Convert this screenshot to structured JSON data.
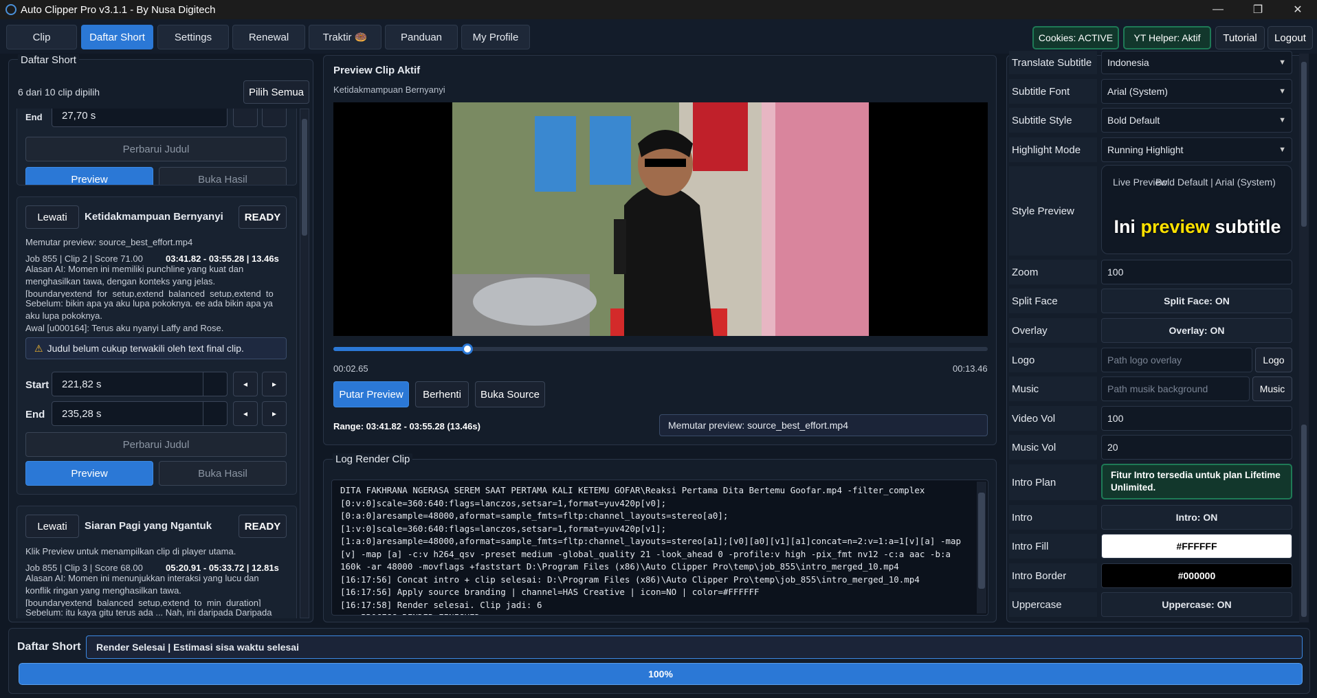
{
  "window": {
    "title": "Auto Clipper Pro v3.1.1 - By Nusa Digitech",
    "min": "—",
    "max": "❐",
    "close": "✕"
  },
  "nav": {
    "tabs": [
      "Clip",
      "Daftar Short",
      "Settings",
      "Renewal",
      "Traktir 🍩",
      "Panduan",
      "My Profile"
    ],
    "cookies": "Cookies: ACTIVE",
    "yt_helper": "YT Helper: Aktif",
    "tutorial": "Tutorial",
    "logout": "Logout"
  },
  "list_panel": {
    "title": "Daftar Short",
    "selected_info": "6 dari 10 clip dipilih",
    "select_all": "Pilih Semua",
    "top_card": {
      "end_label": "End",
      "end_value": "27,70 s",
      "update_title": "Perbarui Judul",
      "preview": "Preview",
      "open_result": "Buka Hasil"
    },
    "clip2": {
      "skip": "Lewati",
      "title": "Ketidakmampuan Bernyanyi",
      "status": "READY",
      "playing": "Memutar preview: source_best_effort.mp4",
      "meta": "Job 855 | Clip 2 | Score 71.00",
      "range": "03:41.82 - 03:55.28 | 13.46s",
      "reason_lines": [
        "Alasan AI: Momen ini memiliki punchline yang kuat dan",
        "menghasilkan tawa, dengan konteks yang jelas.",
        "[boundaryextend_for_setup,extend_balanced_setup,extend_to",
        "Sebelum: bikin apa ya aku lupa pokoknya. ee ada bikin apa ya",
        "aku lupa pokoknya.",
        "Awal [u000164]: Terus aku nyanyi Laffy and Rose."
      ],
      "warning": "Judul belum cukup terwakili oleh text final clip.",
      "start_label": "Start",
      "start_value": "221,82 s",
      "end_label": "End",
      "end_value": "235,28 s",
      "update_title": "Perbarui Judul",
      "preview": "Preview",
      "open_result": "Buka Hasil"
    },
    "clip3": {
      "skip": "Lewati",
      "title": "Siaran Pagi yang Ngantuk",
      "status": "READY",
      "hint": "Klik Preview untuk menampilkan clip di player utama.",
      "meta": "Job 855 | Clip 3 | Score 68.00",
      "range": "05:20.91 - 05:33.72 | 12.81s",
      "reason_lines": [
        "Alasan AI: Momen ini menunjukkan interaksi yang lucu dan",
        "konflik ringan yang menghasilkan tawa.",
        "[boundaryextend_balanced_setup,extend_to_min_duration]",
        "Sebelum: itu kaya gitu terus ada ... Nah, ini daripada Daripada"
      ]
    },
    "spin_prev": "◂",
    "spin_next": "▸"
  },
  "preview": {
    "title": "Preview Clip Aktif",
    "subtitle": "Ketidakmampuan Bernyanyi",
    "progress": 0.205,
    "time_current": "00:02.65",
    "time_total": "00:13.46",
    "play": "Putar Preview",
    "stop": "Berhenti",
    "open_source": "Buka Source",
    "range": "Range: 03:41.82 - 03:55.28 (13.46s)",
    "status": "Memutar preview: source_best_effort.mp4"
  },
  "log": {
    "title": "Log Render Clip",
    "lines": [
      "DITA FAKHRANA NGERASA SEREM SAAT PERTAMA KALI KETEMU GOFAR\\Reaksi Pertama Dita Bertemu Goofar.mp4 -filter_complex",
      "[0:v:0]scale=360:640:flags=lanczos,setsar=1,format=yuv420p[v0];",
      "[0:a:0]aresample=48000,aformat=sample_fmts=fltp:channel_layouts=stereo[a0];",
      "[1:v:0]scale=360:640:flags=lanczos,setsar=1,format=yuv420p[v1];",
      "[1:a:0]aresample=48000,aformat=sample_fmts=fltp:channel_layouts=stereo[a1];[v0][a0][v1][a1]concat=n=2:v=1:a=1[v][a] -map",
      "[v] -map [a] -c:v h264_qsv -preset medium -global_quality 21 -look_ahead 0 -profile:v high -pix_fmt nv12 -c:a aac -b:a",
      "160k -ar 48000 -movflags +faststart D:\\Program Files (x86)\\Auto Clipper Pro\\temp\\job_855\\intro_merged_10.mp4",
      "[16:17:56] Concat intro + clip selesai: D:\\Program Files (x86)\\Auto Clipper Pro\\temp\\job_855\\intro_merged_10.mp4",
      "[16:17:56] Apply source branding | channel=HAS Creative | icon=NO | color=#FFFFFF",
      "[16:17:58] Render selesai. Clip jadi: 6",
      "=== PROCESS RENDER FINISHED ==="
    ]
  },
  "settings": {
    "translate_label": "Translate Subtitle",
    "translate_value": "Indonesia",
    "font_label": "Subtitle Font",
    "font_value": "Arial (System)",
    "style_label": "Subtitle Style",
    "style_value": "Bold Default",
    "highlight_label": "Highlight Mode",
    "highlight_value": "Running Highlight",
    "style_preview_label": "Style Preview",
    "live_preview": "Live Preview",
    "preview_meta": "Bold Default | Arial (System)",
    "sample_a": "Ini",
    "sample_b": "preview",
    "sample_c": "subtitle",
    "zoom_label": "Zoom",
    "zoom_value": "100",
    "split_label": "Split Face",
    "split_value": "Split Face: ON",
    "overlay_label": "Overlay",
    "overlay_value": "Overlay: ON",
    "logo_label": "Logo",
    "logo_placeholder": "Path logo overlay",
    "logo_btn": "Logo",
    "music_label": "Music",
    "music_placeholder": "Path musik background",
    "music_btn": "Music",
    "video_vol_label": "Video Vol",
    "video_vol_value": "100",
    "music_vol_label": "Music Vol",
    "music_vol_value": "20",
    "intro_plan_label": "Intro Plan",
    "intro_plan_value": "Fitur Intro tersedia untuk plan Lifetime Unlimited.",
    "intro_label": "Intro",
    "intro_value": "Intro: ON",
    "intro_fill_label": "Intro Fill",
    "intro_fill_value": "#FFFFFF",
    "intro_border_label": "Intro Border",
    "intro_border_value": "#000000",
    "uppercase_label": "Uppercase",
    "uppercase_value": "Uppercase: ON"
  },
  "footer": {
    "title": "Daftar Short",
    "status": "Render Selesai | Estimasi sisa waktu selesai",
    "progress": 1.0,
    "progress_label": "100%"
  },
  "colors": {
    "accent": "#2b78d6",
    "highlight_word": "#ffe100",
    "green_pill": "#1e7a56"
  }
}
